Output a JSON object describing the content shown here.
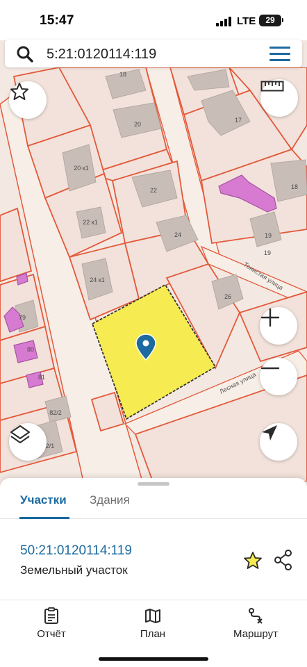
{
  "status": {
    "time": "15:47",
    "network": "LTE",
    "battery": "29"
  },
  "search": {
    "query": "5:21:0120114:119"
  },
  "map": {
    "house_numbers": [
      "18",
      "17",
      "20",
      "20 к1",
      "22",
      "22 к1",
      "24",
      "24 к1",
      "26",
      "18",
      "19",
      "19",
      "79",
      "80",
      "81",
      "82/2",
      "2/1"
    ],
    "streets": [
      "Тенистая улица",
      "Лесная улица"
    ],
    "colors": {
      "selected_parcel": "#f6ec52",
      "parcel_border": "#e3593a",
      "building": "#c9bdb8",
      "highlight_building": "#d77ad1",
      "pin": "#1c6aa0"
    }
  },
  "tabs": [
    {
      "label": "Участки",
      "active": true
    },
    {
      "label": "Здания",
      "active": false
    }
  ],
  "result": {
    "number": "50:21:0120114:119",
    "type": "Земельный участок"
  },
  "nav": [
    {
      "label": "Отчёт",
      "icon": "report-icon"
    },
    {
      "label": "План",
      "icon": "map-plan-icon"
    },
    {
      "label": "Маршрут",
      "icon": "route-icon"
    }
  ]
}
